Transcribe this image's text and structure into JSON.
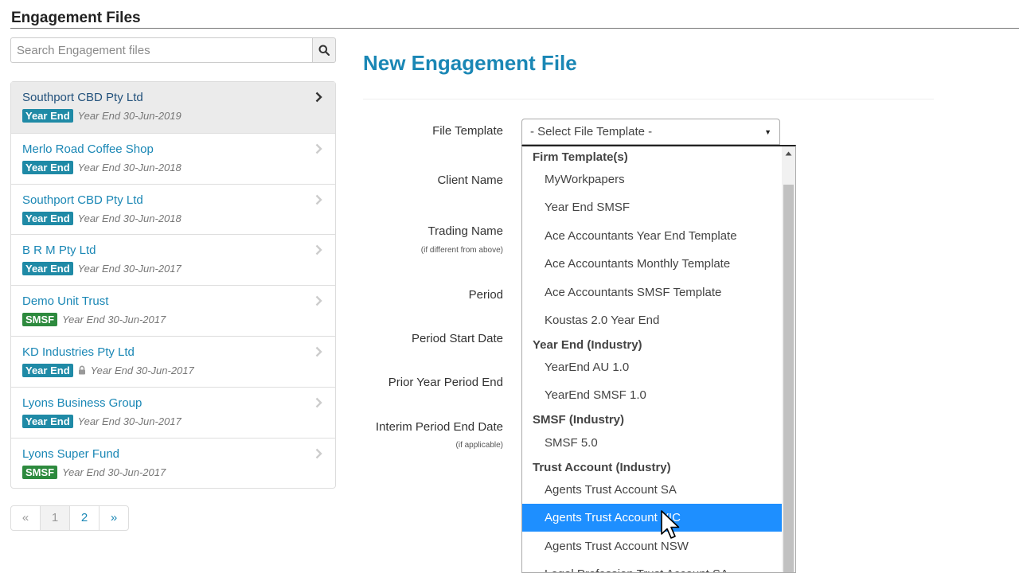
{
  "sidebar": {
    "title": "Engagement Files",
    "search_placeholder": "Search Engagement files",
    "search_icon": "search-icon",
    "files": [
      {
        "name": "Southport CBD Pty Ltd",
        "badge": "Year End",
        "meta": "Year End 30-Jun-2019",
        "active": true
      },
      {
        "name": "Merlo Road Coffee Shop",
        "badge": "Year End",
        "meta": "Year End 30-Jun-2018"
      },
      {
        "name": "Southport CBD Pty Ltd",
        "badge": "Year End",
        "meta": "Year End 30-Jun-2018"
      },
      {
        "name": "B R M Pty Ltd",
        "badge": "Year End",
        "meta": "Year End 30-Jun-2017"
      },
      {
        "name": "Demo Unit Trust",
        "badge": "SMSF",
        "meta": "Year End 30-Jun-2017"
      },
      {
        "name": "KD Industries Pty Ltd",
        "badge": "Year End",
        "meta": "Year End 30-Jun-2017",
        "locked": true
      },
      {
        "name": "Lyons Business Group",
        "badge": "Year End",
        "meta": "Year End 30-Jun-2017"
      },
      {
        "name": "Lyons Super Fund",
        "badge": "SMSF",
        "meta": "Year End 30-Jun-2017"
      }
    ],
    "pagination": {
      "prev": "«",
      "pages": [
        "1",
        "2"
      ],
      "current": "1",
      "next": "»"
    }
  },
  "form": {
    "title": "New Engagement File",
    "labels": {
      "file_template": "File Template",
      "client_name": "Client Name",
      "trading_name": "Trading Name",
      "trading_name_hint": "(if different from above)",
      "period": "Period",
      "period_start": "Period Start Date",
      "prior_year_end": "Prior Year Period End",
      "interim_end": "Interim Period End Date",
      "interim_hint": "(if applicable)"
    },
    "select_value": "- Select File Template -"
  },
  "dropdown": {
    "groups": [
      {
        "label": "Firm Template(s)",
        "options": [
          "MyWorkpapers",
          "Year End SMSF",
          "Ace Accountants Year End Template",
          "Ace Accountants Monthly Template",
          "Ace Accountants SMSF Template",
          "Koustas 2.0 Year End"
        ]
      },
      {
        "label": "Year End (Industry)",
        "options": [
          "YearEnd AU 1.0",
          "YearEnd SMSF 1.0"
        ]
      },
      {
        "label": "SMSF (Industry)",
        "options": [
          "SMSF 5.0"
        ]
      },
      {
        "label": "Trust Account (Industry)",
        "options": [
          "Agents Trust Account SA",
          "Agents Trust Account VIC",
          "Agents Trust Account NSW",
          "Legal Profession Trust Account SA"
        ]
      }
    ],
    "highlighted": "Agents Trust Account VIC"
  },
  "colors": {
    "accent": "#1a87b5",
    "year_end_badge": "#1f8aa6",
    "smsf_badge": "#2d8a3e",
    "highlight": "#1e8fff"
  }
}
